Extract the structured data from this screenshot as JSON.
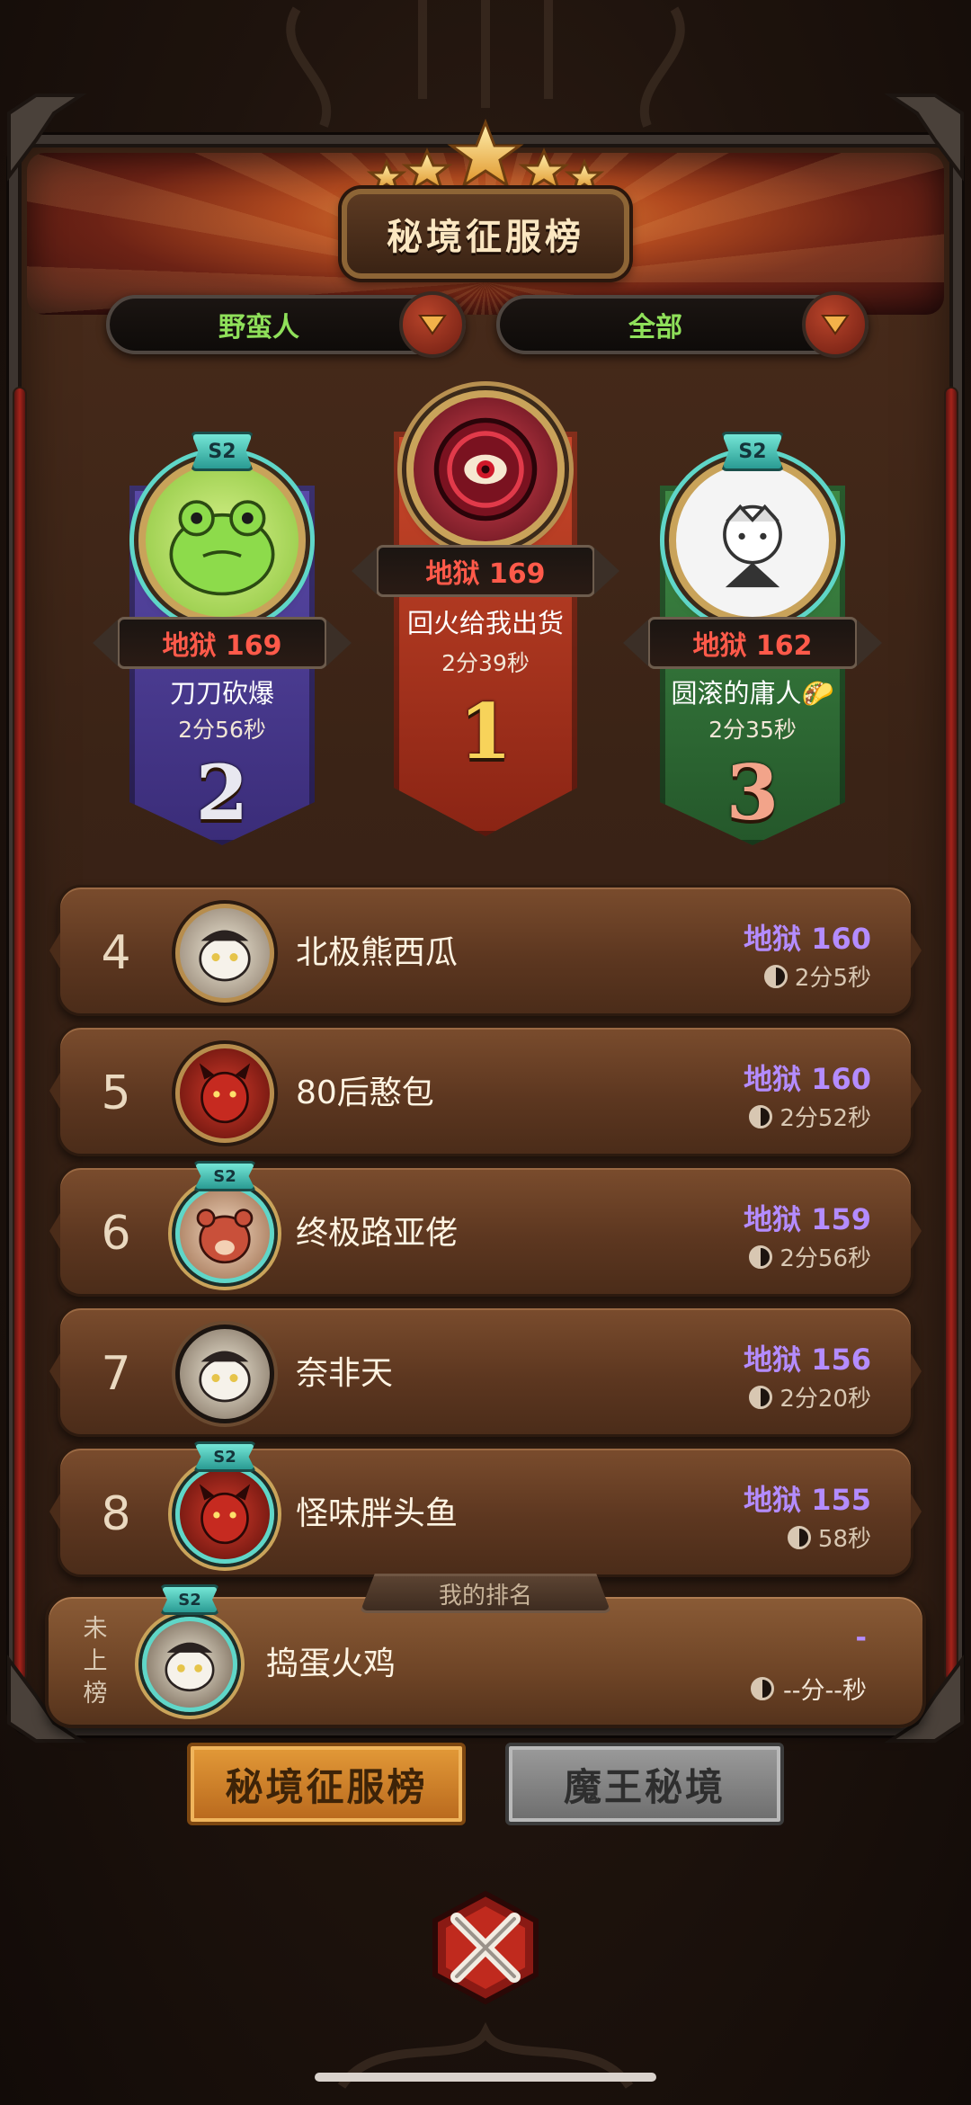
{
  "header": {
    "title": "秘境征服榜",
    "stars": 5
  },
  "filters": {
    "class_filter": "野蛮人",
    "scope_filter": "全部"
  },
  "podium": [
    {
      "place": "1",
      "level": "地狱 169",
      "name": "回火给我出货",
      "time": "2分39秒",
      "avatar_icon": "red-eye-icon",
      "color": "#b23a1e"
    },
    {
      "place": "2",
      "level": "地狱 169",
      "name": "刀刀砍爆",
      "time": "2分56秒",
      "season": "S2",
      "avatar_icon": "frog-icon",
      "color": "#4a3a8c"
    },
    {
      "place": "3",
      "level": "地狱 162",
      "name": "圆滚的庸人🌮",
      "time": "2分35秒",
      "season": "S2",
      "avatar_icon": "sketch-face-icon",
      "color": "#2f6a3a"
    }
  ],
  "ranks": [
    {
      "rank": "4",
      "name": "北极熊西瓜",
      "level": "地狱 160",
      "time": "2分5秒",
      "avatar_icon": "sheep-icon"
    },
    {
      "rank": "5",
      "name": "80后憨包",
      "level": "地狱 160",
      "time": "2分52秒",
      "avatar_icon": "red-demon-icon"
    },
    {
      "rank": "6",
      "name": "终极路亚佬",
      "level": "地狱 159",
      "time": "2分56秒",
      "season": "S2",
      "avatar_icon": "bear-icon"
    },
    {
      "rank": "7",
      "name": "奈非天",
      "level": "地狱 156",
      "time": "2分20秒",
      "avatar_icon": "sheep-icon"
    },
    {
      "rank": "8",
      "name": "怪味胖头鱼",
      "level": "地狱 155",
      "time": "58秒",
      "season": "S2",
      "avatar_icon": "red-demon-icon"
    }
  ],
  "my_rank": {
    "tab_label": "我的排名",
    "status": "未上榜",
    "name": "捣蛋火鸡",
    "level": "-",
    "time": "--分--秒",
    "season": "S2",
    "avatar_icon": "sheep-icon"
  },
  "tabs": {
    "active": "秘境征服榜",
    "inactive": "魔王秘境"
  },
  "colors": {
    "level_purple": "#b48cff",
    "podium_level_red": "#ff5a4a",
    "filter_green": "#8fe05a",
    "accent_teal": "#5fd6c8"
  }
}
